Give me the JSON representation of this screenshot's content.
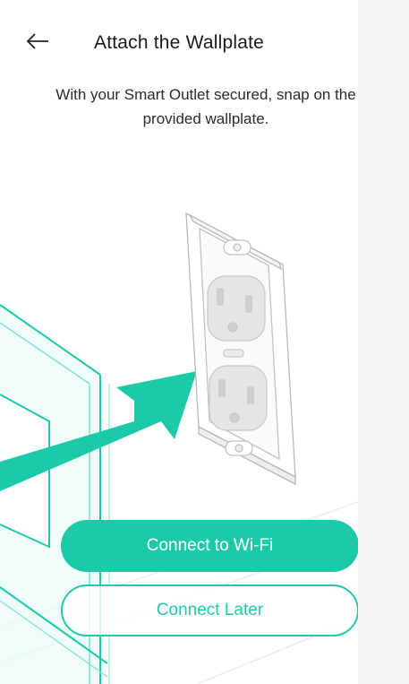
{
  "header": {
    "title": "Attach the Wallplate",
    "back_icon": "back-arrow-icon"
  },
  "content": {
    "instruction": "With your Smart Outlet secured, snap on the provided wallplate."
  },
  "actions": {
    "primary_label": "Connect to Wi-Fi",
    "secondary_label": "Connect Later"
  },
  "colors": {
    "accent": "#1ccaa9",
    "text": "#1a1a1a",
    "side_panel": "#f3f3f3"
  }
}
